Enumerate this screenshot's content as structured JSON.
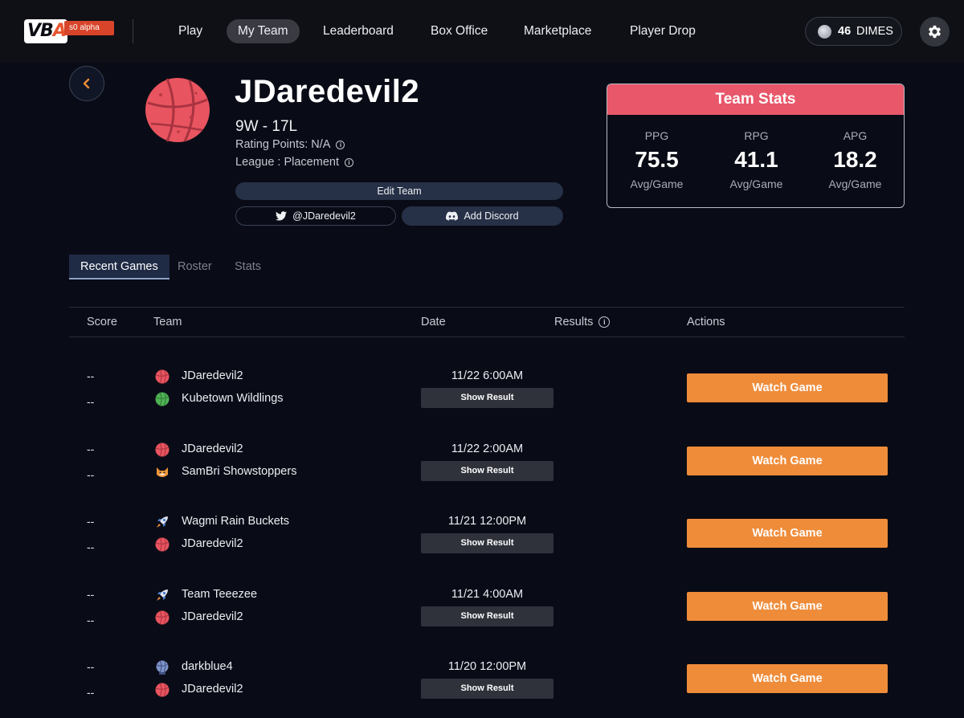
{
  "logo": {
    "mark": "VBA",
    "tag": "s0 alpha"
  },
  "nav": {
    "items": [
      {
        "label": "Play",
        "active": false
      },
      {
        "label": "My Team",
        "active": true
      },
      {
        "label": "Leaderboard",
        "active": false
      },
      {
        "label": "Box Office",
        "active": false
      },
      {
        "label": "Marketplace",
        "active": false
      },
      {
        "label": "Player Drop",
        "active": false
      }
    ]
  },
  "wallet": {
    "amount": "46",
    "unit": "DIMES",
    "icon": "coin-icon"
  },
  "settings": {
    "icon": "gear-icon"
  },
  "profile": {
    "team_name": "JDaredevil2",
    "record": "9W - 17L",
    "rating_points": "Rating Points: N/A",
    "league": "League : Placement",
    "edit_label": "Edit Team",
    "twitter_label": "@JDaredevil2",
    "discord_label": "Add Discord",
    "avatar_color": "#e8545f"
  },
  "team_stats": {
    "title": "Team Stats",
    "stats": [
      {
        "label": "PPG",
        "value": "75.5",
        "sub": "Avg/Game"
      },
      {
        "label": "RPG",
        "value": "41.1",
        "sub": "Avg/Game"
      },
      {
        "label": "APG",
        "value": "18.2",
        "sub": "Avg/Game"
      }
    ],
    "header_color": "#e8576a"
  },
  "tabs": [
    {
      "label": "Recent Games",
      "active": true
    },
    {
      "label": "Roster",
      "active": false
    },
    {
      "label": "Stats",
      "active": false
    }
  ],
  "table": {
    "headers": {
      "score": "Score",
      "team": "Team",
      "date": "Date",
      "results": "Results",
      "actions": "Actions"
    },
    "show_result_label": "Show Result",
    "watch_label": "Watch Game",
    "rows": [
      {
        "score_home": "--",
        "score_away": "--",
        "team_home": "JDaredevil2",
        "team_home_icon": "red-ball-icon",
        "team_away": "Kubetown Wildlings",
        "team_away_icon": "green-ball-icon",
        "date": "11/22 6:00AM"
      },
      {
        "score_home": "--",
        "score_away": "--",
        "team_home": "JDaredevil2",
        "team_home_icon": "red-ball-icon",
        "team_away": "SamBri Showstoppers",
        "team_away_icon": "shiba-icon",
        "date": "11/22 2:00AM"
      },
      {
        "score_home": "--",
        "score_away": "--",
        "team_home": "Wagmi Rain Buckets",
        "team_home_icon": "rocket-icon",
        "team_away": "JDaredevil2",
        "team_away_icon": "red-ball-icon",
        "date": "11/21 12:00PM"
      },
      {
        "score_home": "--",
        "score_away": "--",
        "team_home": "Team Teeezee",
        "team_home_icon": "rocket-icon",
        "team_away": "JDaredevil2",
        "team_away_icon": "red-ball-icon",
        "date": "11/21 4:00AM"
      },
      {
        "score_home": "--",
        "score_away": "--",
        "team_home": "darkblue4",
        "team_home_icon": "blue-ball-icon",
        "team_away": "JDaredevil2",
        "team_away_icon": "red-ball-icon",
        "date": "11/20 12:00PM"
      }
    ]
  },
  "colors": {
    "accent_orange": "#ef8c3a",
    "stats_red": "#e8576a",
    "background": "#090c16"
  }
}
